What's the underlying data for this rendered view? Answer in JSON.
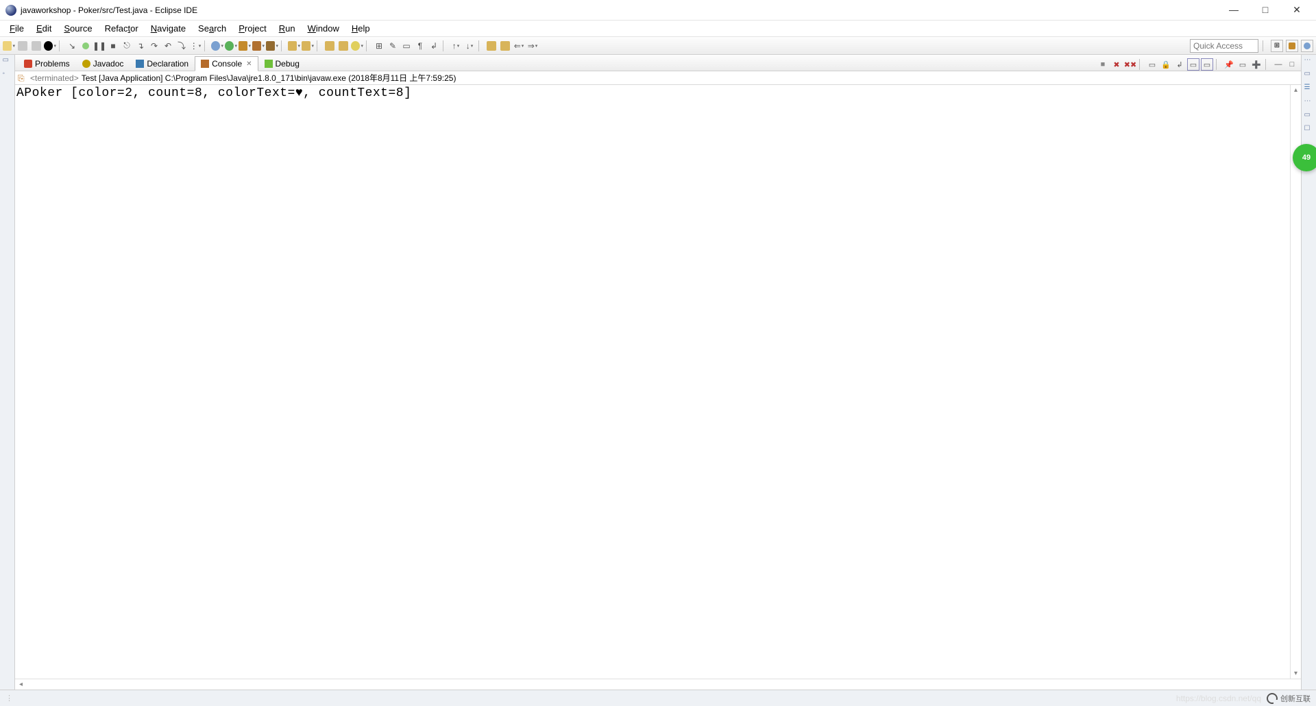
{
  "window": {
    "title": "javaworkshop - Poker/src/Test.java - Eclipse IDE"
  },
  "menu": {
    "items": [
      "File",
      "Edit",
      "Source",
      "Refactor",
      "Navigate",
      "Search",
      "Project",
      "Run",
      "Window",
      "Help"
    ]
  },
  "quickaccess": {
    "placeholder": "Quick Access"
  },
  "viewtabs": {
    "problems": "Problems",
    "javadoc": "Javadoc",
    "declaration": "Declaration",
    "console": "Console",
    "debug": "Debug"
  },
  "console": {
    "status": "<terminated>",
    "launch": "Test [Java Application] C:\\Program Files\\Java\\jre1.8.0_171\\bin\\javaw.exe (2018年8月11日 上午7:59:25)",
    "output": "APoker [color=2, count=8, colorText=♥, countText=8]"
  },
  "statusbar": {
    "watermark": "https://blog.csdn.net/qq",
    "brand": "创新互联"
  },
  "badge": {
    "value": "49"
  }
}
